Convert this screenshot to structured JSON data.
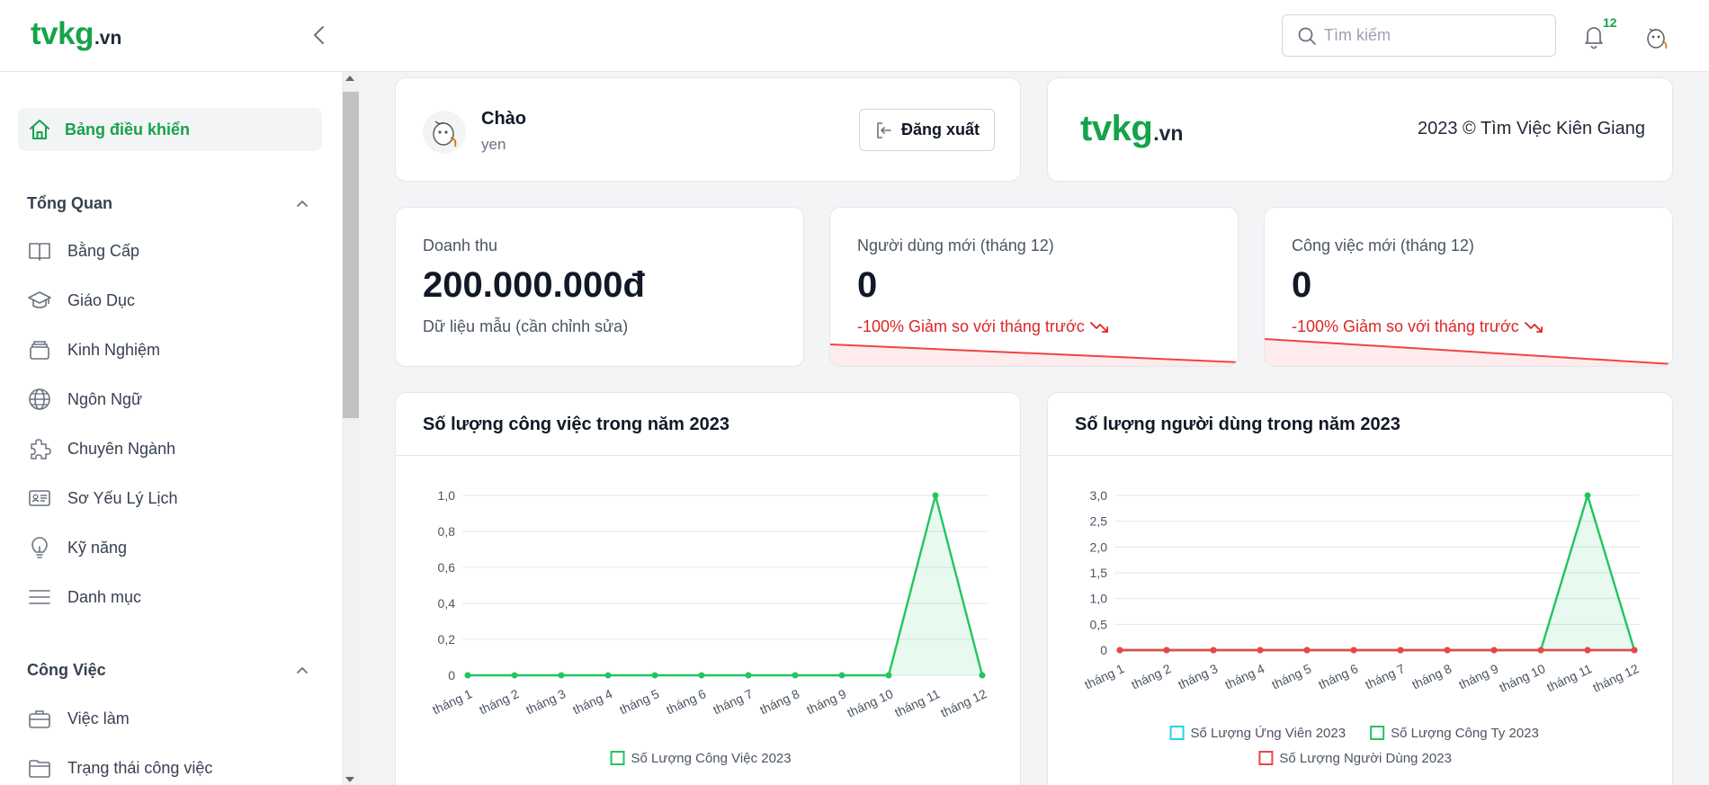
{
  "header": {
    "logo_main": "tvkg",
    "logo_suffix": ".vn",
    "search_placeholder": "Tìm kiếm",
    "notification_count": "12"
  },
  "sidebar": {
    "active": "Bảng điều khiển",
    "sections": [
      {
        "title": "Tổng Quan",
        "items": [
          "Bằng Cấp",
          "Giáo Dục",
          "Kinh Nghiệm",
          "Ngôn Ngữ",
          "Chuyên Ngành",
          "Sơ Yếu Lý Lịch",
          "Kỹ năng",
          "Danh mục"
        ]
      },
      {
        "title": "Công Việc",
        "items": [
          "Việc làm",
          "Trạng thái công việc"
        ]
      }
    ]
  },
  "welcome": {
    "greeting": "Chào",
    "username": "yen",
    "logout_label": "Đăng xuất"
  },
  "brand": {
    "logo_main": "tvkg",
    "logo_suffix": ".vn",
    "copyright": "2023 © Tìm Việc Kiên Giang"
  },
  "stats": [
    {
      "label": "Doanh thu",
      "value": "200.000.000đ",
      "note": "Dữ liệu mẫu (cần chỉnh sửa)"
    },
    {
      "label": "Người dùng mới (tháng 12)",
      "value": "0",
      "trend": "-100% Giảm so với tháng trước"
    },
    {
      "label": "Công việc mới (tháng 12)",
      "value": "0",
      "trend": "-100% Giảm so với tháng trước"
    }
  ],
  "colors": {
    "brand_green": "#16a34a",
    "chart_green": "#22c55e",
    "chart_cyan": "#22d3ee",
    "chart_red": "#ef4444",
    "trend_red": "#dc2626"
  },
  "chart_data": [
    {
      "type": "line",
      "title": "Số lượng công việc trong năm 2023",
      "categories": [
        "tháng 1",
        "tháng 2",
        "tháng 3",
        "tháng 4",
        "tháng 5",
        "tháng 6",
        "tháng 7",
        "tháng 8",
        "tháng 9",
        "tháng 10",
        "tháng 11",
        "tháng 12"
      ],
      "yticks": [
        "0",
        "0,2",
        "0,4",
        "0,6",
        "0,8",
        "1,0"
      ],
      "ylim": [
        0,
        1
      ],
      "grid": true,
      "legend_position": "bottom",
      "series": [
        {
          "name": "Số Lượng Công Việc 2023",
          "color": "#22c55e",
          "fill": true,
          "values": [
            0,
            0,
            0,
            0,
            0,
            0,
            0,
            0,
            0,
            0,
            1,
            0
          ]
        }
      ]
    },
    {
      "type": "line",
      "title": "Số lượng người dùng trong năm 2023",
      "categories": [
        "tháng 1",
        "tháng 2",
        "tháng 3",
        "tháng 4",
        "tháng 5",
        "tháng 6",
        "tháng 7",
        "tháng 8",
        "tháng 9",
        "tháng 10",
        "tháng 11",
        "tháng 12"
      ],
      "yticks": [
        "0",
        "0,5",
        "1,0",
        "1,5",
        "2,0",
        "2,5",
        "3,0"
      ],
      "ylim": [
        0,
        3
      ],
      "grid": true,
      "legend_position": "bottom",
      "series": [
        {
          "name": "Số Lượng Ứng Viên 2023",
          "color": "#22d3ee",
          "fill": false,
          "values": [
            0,
            0,
            0,
            0,
            0,
            0,
            0,
            0,
            0,
            0,
            0,
            0
          ]
        },
        {
          "name": "Số Lượng Công Ty 2023",
          "color": "#22c55e",
          "fill": true,
          "values": [
            0,
            0,
            0,
            0,
            0,
            0,
            0,
            0,
            0,
            0,
            3,
            0
          ]
        },
        {
          "name": "Số Lượng Người Dùng 2023",
          "color": "#ef4444",
          "fill": false,
          "values": [
            0,
            0,
            0,
            0,
            0,
            0,
            0,
            0,
            0,
            0,
            0,
            0
          ]
        }
      ]
    }
  ]
}
